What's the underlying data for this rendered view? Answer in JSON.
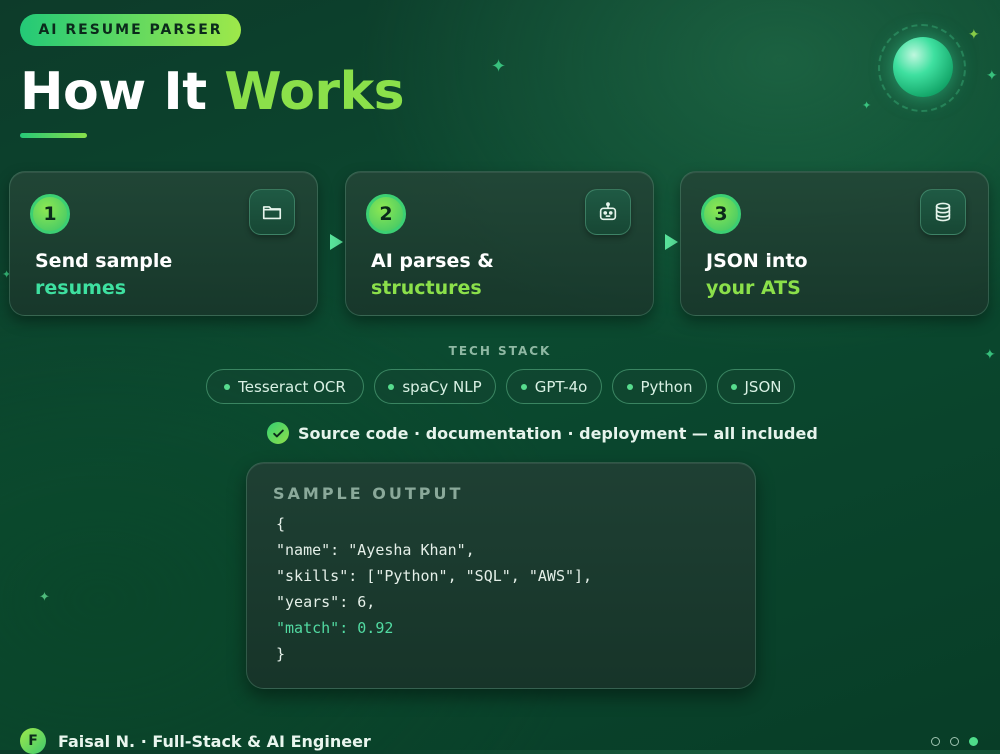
{
  "badge": "AI RESUME PARSER",
  "title": {
    "main": "How It",
    "accent": "Works"
  },
  "steps": [
    {
      "number": "1",
      "line1": "Send sample",
      "line2": "resumes",
      "icon": "folder-icon"
    },
    {
      "number": "2",
      "line1": "AI parses &",
      "line2": "structures",
      "icon": "robot-icon"
    },
    {
      "number": "3",
      "line1": "JSON into",
      "line2": "your ATS",
      "icon": "database-icon"
    }
  ],
  "tech_stack": {
    "label": "TECH STACK",
    "items": [
      "Tesseract OCR",
      "spaCy NLP",
      "GPT-4o",
      "Python",
      "JSON"
    ]
  },
  "included": "Source code · documentation · deployment — all included",
  "sample_output": {
    "title": "SAMPLE OUTPUT",
    "lines": [
      "{",
      "\"name\": \"Ayesha Khan\",",
      "\"skills\": [\"Python\", \"SQL\", \"AWS\"],",
      "\"years\": 6,",
      "\"match\": 0.92",
      "}"
    ]
  },
  "footer": {
    "avatar_letter": "F",
    "text": "Faisal N. · Full-Stack & AI Engineer"
  },
  "pager": {
    "total": 3,
    "active": 3
  },
  "colors": {
    "accent_lime": "#8be04a",
    "accent_teal": "#3ee0a0",
    "background": "#0b4a30"
  }
}
